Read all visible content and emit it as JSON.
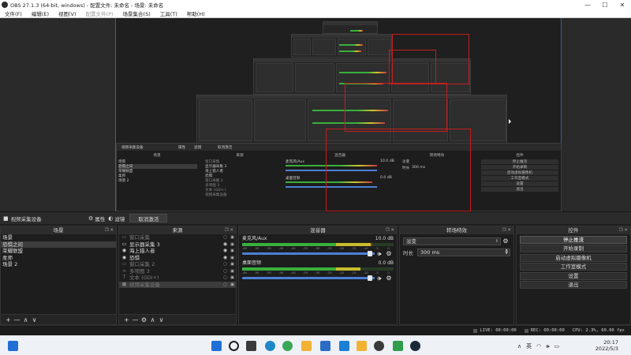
{
  "window": {
    "title": "OBS 27.1.3 (64-bit, windows) - 配置文件: 未命名 - 场景: 未命名",
    "minimize": "—",
    "maximize": "☐",
    "close": "✕"
  },
  "menu": [
    {
      "label": "文件(F)",
      "enabled": true
    },
    {
      "label": "编辑(E)",
      "enabled": true
    },
    {
      "label": "视图(V)",
      "enabled": true
    },
    {
      "label": "配置文件(P)",
      "enabled": false
    },
    {
      "label": "场景集合(S)",
      "enabled": true
    },
    {
      "label": "工具(T)",
      "enabled": true
    },
    {
      "label": "帮助(H)",
      "enabled": true
    }
  ],
  "context_bar": {
    "source_name": "视频采集设备",
    "properties": "属性",
    "filters": "滤镜",
    "deactivate": "取消激活"
  },
  "scenes": {
    "title": "场景",
    "items": [
      {
        "label": "场景",
        "selected": false
      },
      {
        "label": "恐惧之间",
        "selected": true
      },
      {
        "label": "荣耀联盟",
        "selected": false
      },
      {
        "label": "柔师",
        "selected": false
      },
      {
        "label": "场景 2",
        "selected": false
      }
    ]
  },
  "sources": {
    "title": "来源",
    "items": [
      {
        "label": "窗口采集",
        "icon": "window-icon",
        "visible": false,
        "selected": false
      },
      {
        "label": "显示器采集 3",
        "icon": "monitor-icon",
        "visible": true,
        "selected": false
      },
      {
        "label": "海上猎人者",
        "icon": "eye-icon",
        "visible": true,
        "selected": false
      },
      {
        "label": "恐惧",
        "icon": "eye-icon",
        "visible": true,
        "selected": false
      },
      {
        "label": "窗口采集 2",
        "icon": "window-icon",
        "visible": false,
        "selected": false
      },
      {
        "label": "多项图 3",
        "icon": "link-icon",
        "visible": false,
        "selected": false
      },
      {
        "label": "文本 (GDI+)",
        "icon": "text-icon",
        "visible": false,
        "selected": false
      },
      {
        "label": "视频采集设备",
        "icon": "camera-icon",
        "visible": false,
        "selected": true
      }
    ]
  },
  "mixer": {
    "title": "混音器",
    "channels": [
      {
        "name": "麦克风/Aux",
        "db": "10.0 dB",
        "level": 0.86,
        "fader": 0.98
      },
      {
        "name": "桌面音频",
        "db": "0.0 dB",
        "level": 0.78,
        "fader": 0.98
      }
    ],
    "scale": [
      "-60",
      "-55",
      "-50",
      "-45",
      "-40",
      "-35",
      "-30",
      "-25",
      "-20",
      "-15",
      "-10",
      "-5",
      "0"
    ]
  },
  "transitions": {
    "title": "转场特效",
    "type": "淡变",
    "duration_label": "时长",
    "duration": "300 ms"
  },
  "controls": {
    "title": "控件",
    "buttons": [
      {
        "label": "停止推流",
        "active": true
      },
      {
        "label": "开始录制",
        "active": false
      },
      {
        "label": "启动虚拟摄像机",
        "active": false
      },
      {
        "label": "工作室模式",
        "active": false
      },
      {
        "label": "设置",
        "active": false
      },
      {
        "label": "退出",
        "active": false
      }
    ]
  },
  "status": {
    "live": "LIVE: 00:00:00",
    "rec": "REC: 00:00:00",
    "cpu": "CPU: 2.3%, 60.00 fps"
  },
  "nested_preview": {
    "context_source": "视频采集设备",
    "properties": "属性",
    "filters": "滤镜",
    "deactivate": "取消激活",
    "scenes_title": "场景",
    "sources_title": "来源",
    "mixer_title": "混音器",
    "transitions_title": "转场特效",
    "controls_title": "控件",
    "scenes": [
      "场景",
      "恐惧之间",
      "荣耀联盟",
      "柔师",
      "场景 2"
    ],
    "sources": [
      "窗口采集",
      "显示器采集 3",
      "海上猎人者",
      "恐惧",
      "窗口采集 2",
      "多项图 3",
      "文本 (GDI+)",
      "视频采集设备"
    ],
    "channels": [
      {
        "name": "麦克风/Aux",
        "db": "10.0 dB"
      },
      {
        "name": "桌面音频",
        "db": "0.0 dB"
      }
    ],
    "transition": "淡变",
    "duration_label": "时长",
    "duration": "300 ms",
    "buttons": [
      "停止推流",
      "开始录制",
      "启动虚拟摄像机",
      "工作室模式",
      "设置",
      "退出"
    ]
  },
  "taskbar": {
    "language": "英",
    "time": "20:17",
    "date": "2022/5/3",
    "icon_colors": {
      "start": "#1f6fd6",
      "search": "#202020",
      "taskview": "#3a3a3a",
      "edge": "#1e88c8",
      "chrome": "#3aa757",
      "explorer": "#f2b233",
      "store": "#2b6cc4",
      "mail": "#1a7fd6",
      "xbox": "#2f9d4c",
      "steam": "#1b2838"
    }
  },
  "colors": {
    "accent_blue": "#4d7fd6",
    "selection_red": "#c41e1e",
    "meter_green": "#38b03b",
    "meter_yellow": "#c9bd2d",
    "meter_red": "#9a3030"
  }
}
